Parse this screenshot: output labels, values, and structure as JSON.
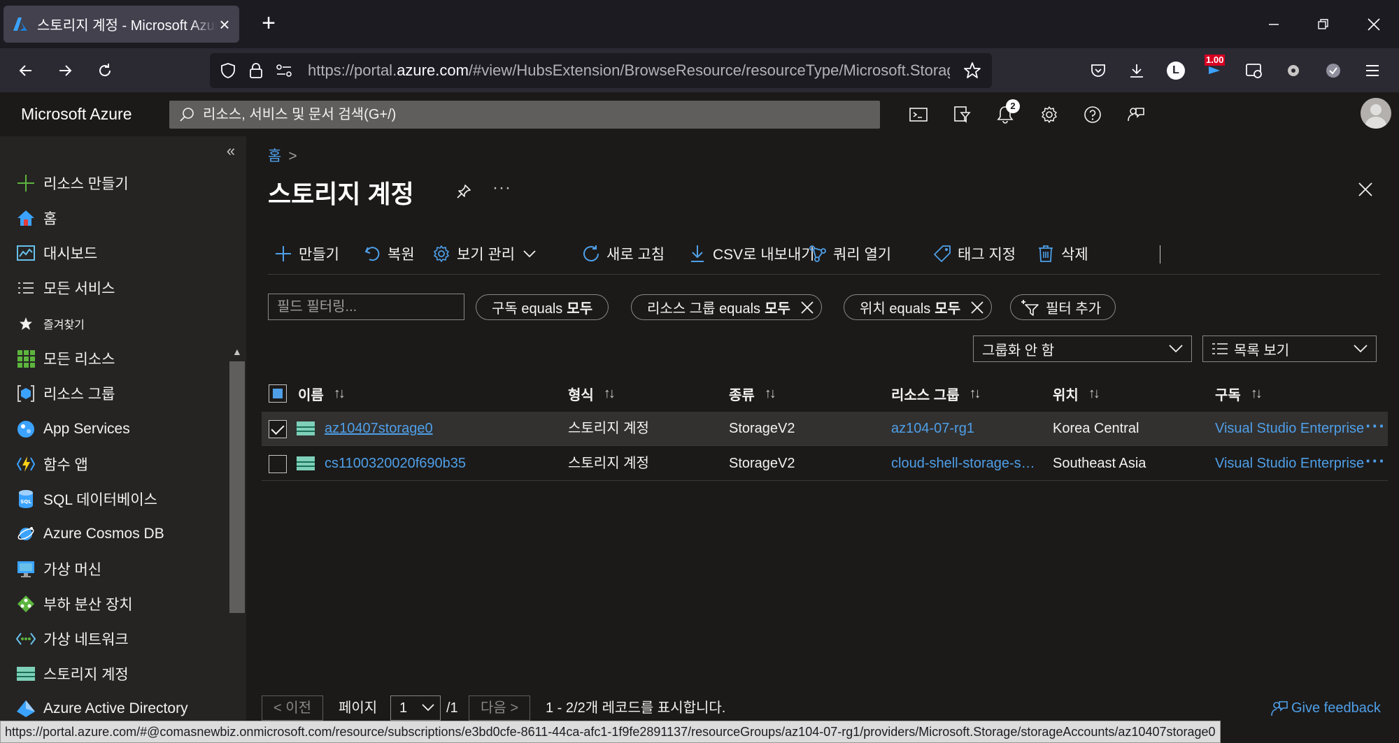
{
  "browser": {
    "tab_title": "스토리지 계정 - Microsoft Azure",
    "new_tab": "+",
    "url_prefix": "https://portal.",
    "url_domain": "azure.com",
    "url_rest": "/#view/HubsExtension/BrowseResource/resourceType/Microsoft.Storage",
    "profile_initial": "L",
    "extension_badge": "1.00",
    "status_url": "https://portal.azure.com/#@comasnewbiz.onmicrosoft.com/resource/subscriptions/e3bd0cfe-8611-44ca-afc1-1f9fe2891137/resourceGroups/az104-07-rg1/providers/Microsoft.Storage/storageAccounts/az10407storage0"
  },
  "azure_header": {
    "brand": "Microsoft Azure",
    "search_placeholder": "리소스, 서비스 및 문서 검색(G+/)",
    "notification_count": "2",
    "accent": "#0078d4"
  },
  "sidebar": {
    "collapse": "«",
    "items": [
      {
        "label": "리소스 만들기",
        "icon": "plus-icon"
      },
      {
        "label": "홈",
        "icon": "home-icon"
      },
      {
        "label": "대시보드",
        "icon": "dashboard-icon"
      },
      {
        "label": "모든 서비스",
        "icon": "list-icon"
      },
      {
        "label": "즐겨찾기",
        "icon": "star-icon"
      },
      {
        "label": "모든 리소스",
        "icon": "grid-icon"
      },
      {
        "label": "리소스 그룹",
        "icon": "resource-group-icon"
      },
      {
        "label": "App Services",
        "icon": "app-services-icon"
      },
      {
        "label": "함수 앱",
        "icon": "function-app-icon"
      },
      {
        "label": "SQL 데이터베이스",
        "icon": "sql-database-icon"
      },
      {
        "label": "Azure Cosmos DB",
        "icon": "cosmos-db-icon"
      },
      {
        "label": "가상 머신",
        "icon": "virtual-machine-icon"
      },
      {
        "label": "부하 분산 장치",
        "icon": "load-balancer-icon"
      },
      {
        "label": "가상 네트워크",
        "icon": "virtual-network-icon"
      },
      {
        "label": "스토리지 계정",
        "icon": "storage-account-icon"
      },
      {
        "label": "Azure Active Directory",
        "icon": "active-directory-icon"
      }
    ]
  },
  "page": {
    "breadcrumb_home": "홈",
    "breadcrumb_sep": ">",
    "title": "스토리지 계정",
    "more": "···"
  },
  "commands": [
    {
      "label": "만들기",
      "icon": "plus-icon"
    },
    {
      "label": "복원",
      "icon": "undo-icon"
    },
    {
      "label": "보기 관리",
      "icon": "gear-icon"
    },
    {
      "label": "새로 고침",
      "icon": "refresh-icon"
    },
    {
      "label": "CSV로 내보내기",
      "icon": "download-icon"
    },
    {
      "label": "쿼리 열기",
      "icon": "query-icon"
    },
    {
      "label": "태그 지정",
      "icon": "tag-icon"
    },
    {
      "label": "삭제",
      "icon": "trash-icon"
    }
  ],
  "filters": {
    "placeholder": "필드 필터링...",
    "pills": [
      {
        "prefix": "구독 equals",
        "value": "모두"
      },
      {
        "prefix": "리소스 그룹 equals",
        "value": "모두"
      },
      {
        "prefix": "위치 equals",
        "value": "모두"
      }
    ],
    "add_filter": "필터 추가",
    "grouping": "그룹화 안 함",
    "view": "목록 보기"
  },
  "table": {
    "columns": [
      "이름",
      "형식",
      "종류",
      "리소스 그룹",
      "위치",
      "구독"
    ],
    "sort_glyph": "↑↓",
    "rows": [
      {
        "name": "az10407storage0",
        "type": "스토리지 계정",
        "kind": "StorageV2",
        "resource_group": "az104-07-rg1",
        "location": "Korea Central",
        "subscription": "Visual Studio Enterprise",
        "selected": true
      },
      {
        "name": "cs1100320020f690b35",
        "type": "스토리지 계정",
        "kind": "StorageV2",
        "resource_group": "cloud-shell-storage-southeastasia",
        "location": "Southeast Asia",
        "subscription": "Visual Studio Enterprise",
        "selected": false
      }
    ],
    "row_more": "···"
  },
  "pager": {
    "prev": "< 이전",
    "page_label": "페이지",
    "page_value": "1",
    "page_total": "/1",
    "next": "다음 >",
    "records": "1 - 2/2개 레코드를 표시합니다.",
    "feedback": "Give feedback"
  }
}
